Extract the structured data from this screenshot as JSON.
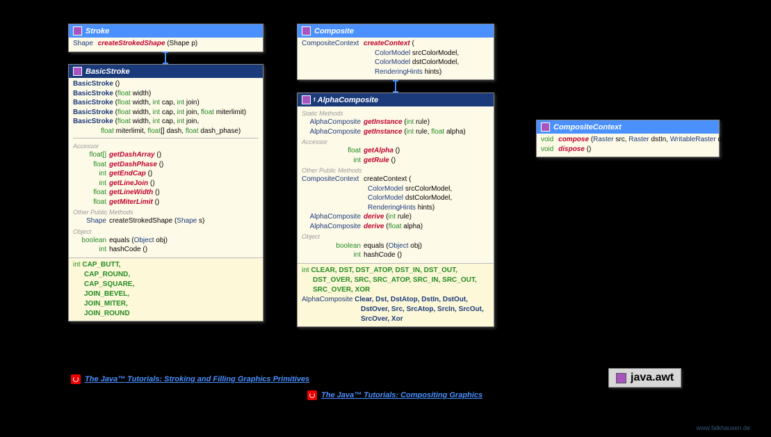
{
  "stroke": {
    "title": "Stroke",
    "rtype": "Shape",
    "method": "createStrokedShape",
    "params": "(Shape p)"
  },
  "basicStroke": {
    "title": "BasicStroke",
    "ctors": [
      {
        "name": "BasicStroke",
        "params": "()"
      },
      {
        "name": "BasicStroke",
        "params": "(float width)"
      },
      {
        "name": "BasicStroke",
        "params": "(float width, int cap, int join)"
      },
      {
        "name": "BasicStroke",
        "params": "(float width, int cap, int join, float miterlimit)"
      },
      {
        "name": "BasicStroke",
        "params": "(float width, int cap, int join,",
        "cont": "float miterlimit, float[] dash, float dash_phase)"
      }
    ],
    "accessor_label": "Accessor",
    "accessors": [
      {
        "rtype": "float[]",
        "name": "getDashArray",
        "p": "()"
      },
      {
        "rtype": "float",
        "name": "getDashPhase",
        "p": "()"
      },
      {
        "rtype": "int",
        "name": "getEndCap",
        "p": "()"
      },
      {
        "rtype": "int",
        "name": "getLineJoin",
        "p": "()"
      },
      {
        "rtype": "float",
        "name": "getLineWidth",
        "p": "()"
      },
      {
        "rtype": "float",
        "name": "getMiterLimit",
        "p": "()"
      }
    ],
    "other_label": "Other Public Methods",
    "other": {
      "rtype": "Shape",
      "name": "createStrokedShape",
      "p": "(Shape s)"
    },
    "object_label": "Object",
    "eq": {
      "rtype": "boolean",
      "name": "equals",
      "p": "(Object obj)"
    },
    "hc": {
      "rtype": "int",
      "name": "hashCode",
      "p": "()"
    },
    "ctype": "int",
    "constants": "CAP_BUTT, CAP_ROUND, CAP_SQUARE, JOIN_BEVEL, JOIN_MITER, JOIN_ROUND"
  },
  "composite": {
    "title": "Composite",
    "rtype": "CompositeContext",
    "method": "createContext",
    "l1": "ColorModel srcColorModel,",
    "l2": "ColorModel dstColorModel,",
    "l3": "RenderingHints hints)"
  },
  "alphaComposite": {
    "title": "AlphaComposite",
    "modifier": "f",
    "static_label": "Static Methods",
    "gi1": {
      "rtype": "AlphaComposite",
      "name": "getInstance",
      "p": "(int rule)"
    },
    "gi2": {
      "rtype": "AlphaComposite",
      "name": "getInstance",
      "p": "(int rule, float alpha)"
    },
    "accessor_label": "Accessor",
    "ga": {
      "rtype": "float",
      "name": "getAlpha",
      "p": "()"
    },
    "gr": {
      "rtype": "int",
      "name": "getRule",
      "p": "()"
    },
    "other_label": "Other Public Methods",
    "cc": {
      "rtype": "CompositeContext",
      "name": "createContext",
      "l1": "ColorModel srcColorModel,",
      "l2": "ColorModel dstColorModel,",
      "l3": "RenderingHints hints)"
    },
    "d1": {
      "rtype": "AlphaComposite",
      "name": "derive",
      "p": "(int rule)"
    },
    "d2": {
      "rtype": "AlphaComposite",
      "name": "derive",
      "p": "(float alpha)"
    },
    "object_label": "Object",
    "eq": {
      "rtype": "boolean",
      "name": "equals",
      "p": "(Object obj)"
    },
    "hc": {
      "rtype": "int",
      "name": "hashCode",
      "p": "()"
    },
    "ctype1": "int",
    "constants1": "CLEAR, DST, DST_ATOP, DST_IN, DST_OUT, DST_OVER, SRC, SRC_ATOP, SRC_IN, SRC_OUT, SRC_OVER, XOR",
    "ctype2": "AlphaComposite",
    "constants2": "Clear, Dst, DstAtop, DstIn, DstOut, DstOver, Src, SrcAtop, SrcIn, SrcOut, SrcOver, Xor"
  },
  "compositeContext": {
    "title": "CompositeContext",
    "m1": {
      "rtype": "void",
      "name": "compose",
      "p": "(Raster src, Raster dstIn, WritableRaster dstOut)"
    },
    "m2": {
      "rtype": "void",
      "name": "dispose",
      "p": "()"
    }
  },
  "link1": "The Java™ Tutorials: Stroking and Filling Graphics Primitives",
  "link2": "The Java™ Tutorials: Compositing Graphics",
  "package": "java.awt",
  "credit": "www.falkhausen.de"
}
